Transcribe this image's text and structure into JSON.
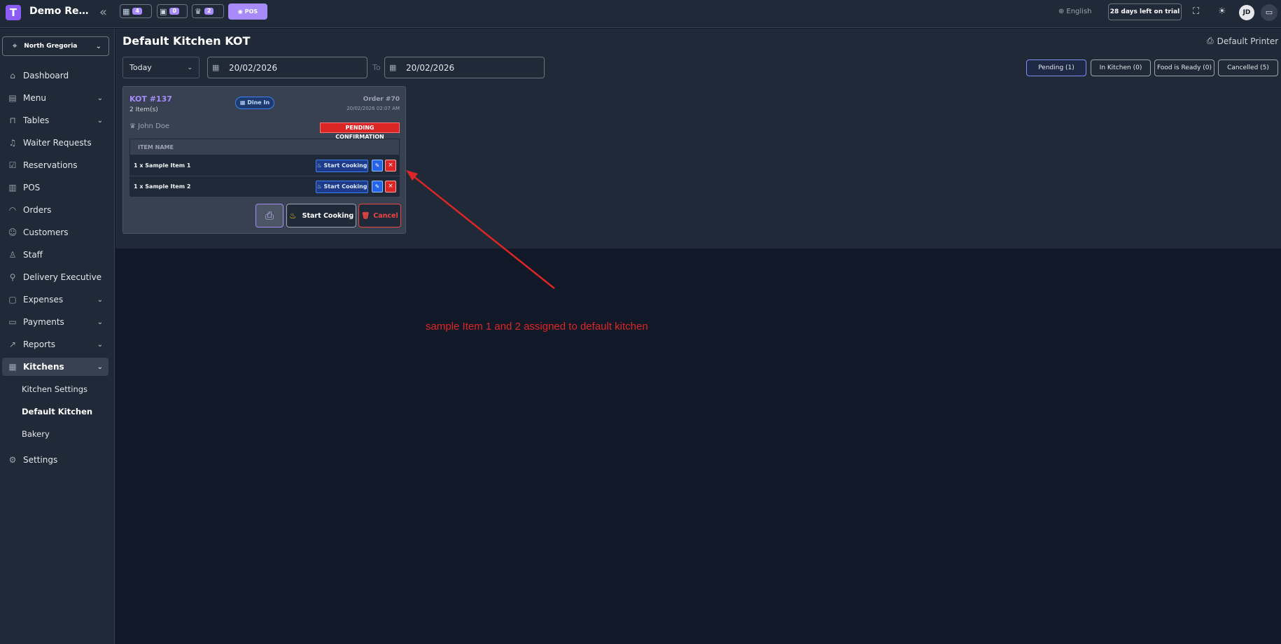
{
  "topbar": {
    "logo_letter": "T",
    "app_title": "Demo Restaurant",
    "chips": [
      {
        "icon": "table-icon",
        "count": "4"
      },
      {
        "icon": "calendar-icon",
        "count": "0"
      },
      {
        "icon": "waiter-icon",
        "count": "2"
      }
    ],
    "pos_label": "POS",
    "language": "English",
    "trial": "28 days left on trial",
    "avatar_initials": "JD"
  },
  "sidebar": {
    "branch": "North Gregoria",
    "items": [
      {
        "label": "Dashboard",
        "icon": "home-icon"
      },
      {
        "label": "Menu",
        "icon": "menu-book-icon"
      },
      {
        "label": "Tables",
        "icon": "table-icon"
      },
      {
        "label": "Waiter Requests",
        "icon": "bell-icon"
      },
      {
        "label": "Reservations",
        "icon": "calendar-check-icon"
      },
      {
        "label": "POS",
        "icon": "pos-icon"
      },
      {
        "label": "Orders",
        "icon": "cloche-icon"
      },
      {
        "label": "Customers",
        "icon": "users-icon"
      },
      {
        "label": "Staff",
        "icon": "staff-icon"
      },
      {
        "label": "Delivery Executive",
        "icon": "scooter-icon"
      },
      {
        "label": "Expenses",
        "icon": "wallet-icon"
      },
      {
        "label": "Payments",
        "icon": "folder-icon"
      },
      {
        "label": "Reports",
        "icon": "chart-icon"
      },
      {
        "label": "Kitchens",
        "icon": "kitchen-icon"
      }
    ],
    "sub_items": [
      "Kitchen Settings",
      "Default Kitchen",
      "Bakery"
    ],
    "settings": "Settings"
  },
  "header": {
    "title": "Default Kitchen KOT",
    "printer": "Default Printer"
  },
  "filters": {
    "range": "Today",
    "from_date": "20/02/2026",
    "to_label": "To",
    "to_date": "20/02/2026",
    "status_tabs": [
      "Pending (1)",
      "In Kitchen (0)",
      "Food is Ready (0)",
      "Cancelled (5)"
    ]
  },
  "kot": {
    "number": "KOT #137",
    "item_count": "2 Item(s)",
    "order_type": "Dine In",
    "order_no": "Order #70",
    "time": "20/02/2026 02:07 AM",
    "waiter": "John Doe",
    "status": "PENDING CONFIRMATION",
    "column_header": "ITEM NAME",
    "items": [
      {
        "name": "1 x Sample Item 1",
        "action": "Start Cooking"
      },
      {
        "name": "1 x Sample Item 2",
        "action": "Start Cooking"
      }
    ],
    "start_label": "Start Cooking",
    "cancel_label": "Cancel"
  },
  "annotation": {
    "text": "sample Item 1 and 2 assigned to default kitchen",
    "color": "#dc2626"
  }
}
